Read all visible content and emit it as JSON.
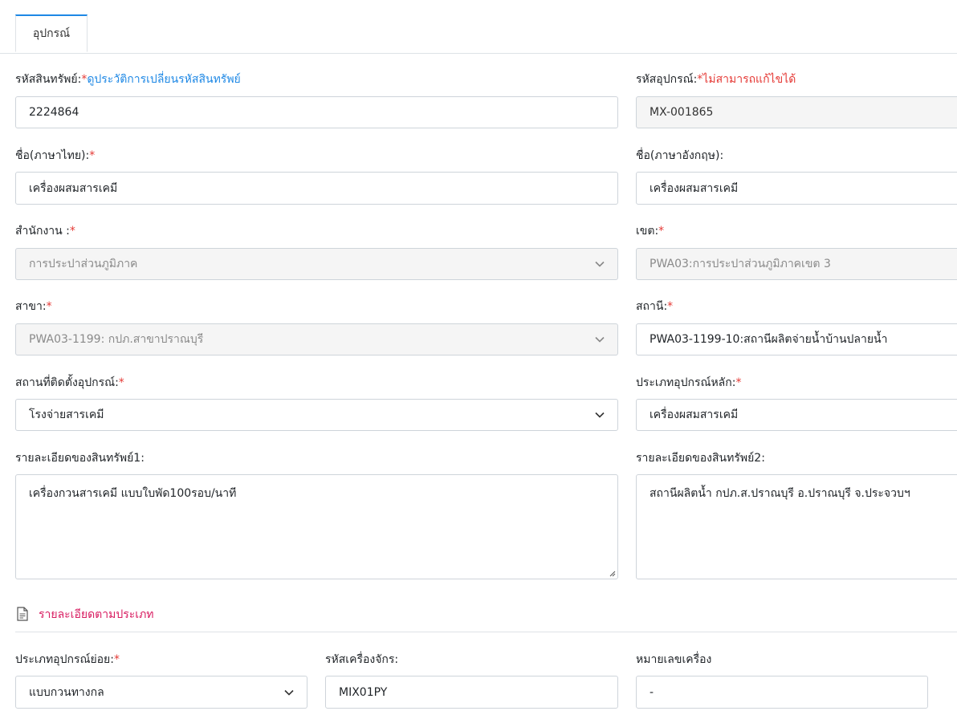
{
  "tab": {
    "label": "อุปกรณ์"
  },
  "asset_code": {
    "label": "รหัสสินทรัพย์:",
    "required": "*",
    "link": "ดูประวัติการเปลี่ยนรหัสสินทรัพย์",
    "value": "2224864"
  },
  "equipment_code": {
    "label": "รหัสอุปกรณ์:",
    "required": "*",
    "note": "ไม่สามารถแก้ไขได้",
    "value": "MX-001865"
  },
  "name_th": {
    "label": "ชื่อ(ภาษาไทย):",
    "required": "*",
    "value": "เครื่องผสมสารเคมี"
  },
  "name_en": {
    "label": "ชื่อ(ภาษาอังกฤษ):",
    "value": "เครื่องผสมสารเคมี"
  },
  "office": {
    "label": "สำนักงาน :",
    "required": "*",
    "value": "การประปาส่วนภูมิภาค"
  },
  "zone": {
    "label": "เขต:",
    "required": "*",
    "value": "PWA03:การประปาส่วนภูมิภาคเขต 3"
  },
  "branch": {
    "label": "สาขา:",
    "required": "*",
    "value": "PWA03-1199: กปภ.สาขาปราณบุรี"
  },
  "station": {
    "label": "สถานี:",
    "required": "*",
    "value": "PWA03-1199-10:สถานีผลิตจ่ายน้ำบ้านปลายน้ำ"
  },
  "install_location": {
    "label": "สถานที่ติดตั้งอุปกรณ์:",
    "required": "*",
    "value": "โรงจ่ายสารเคมี"
  },
  "main_type": {
    "label": "ประเภทอุปกรณ์หลัก:",
    "required": "*",
    "value": "เครื่องผสมสารเคมี"
  },
  "asset_detail1": {
    "label": "รายละเอียดของสินทรัพย์1:",
    "value": "เครื่องกวนสารเคมี แบบใบพัด100รอบ/นาที"
  },
  "asset_detail2": {
    "label": "รายละเอียดของสินทรัพย์2:",
    "value": "สถานีผลิตน้ำ กปภ.ส.ปราณบุรี อ.ปราณบุรี จ.ประจวบฯ"
  },
  "section": {
    "title": "รายละเอียดตามประเภท"
  },
  "sub_type": {
    "label": "ประเภทอุปกรณ์ย่อย:",
    "required": "*",
    "value": "แบบกวนทางกล"
  },
  "machine_code": {
    "label": "รหัสเครื่องจักร:",
    "value": "MIX01PY"
  },
  "machine_number": {
    "label": "หมายเลขเครื่อง",
    "value": "-"
  }
}
